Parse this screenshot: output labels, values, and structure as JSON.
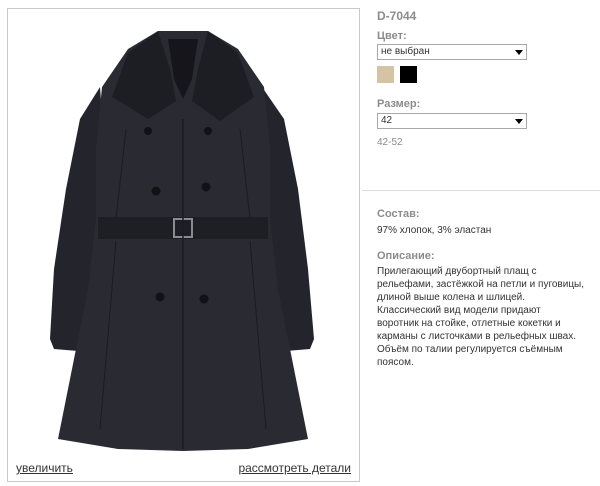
{
  "product": {
    "sku": "D-7044",
    "color_label": "Цвет:",
    "color_selected": "не выбран",
    "swatches": [
      {
        "name": "beige",
        "color": "#d6c3a3"
      },
      {
        "name": "black",
        "color": "#000000"
      }
    ],
    "size_label": "Размер:",
    "size_selected": "42",
    "size_range": "42-52",
    "composition_label": "Состав:",
    "composition": "97% хлопок, 3% эластан",
    "description_label": "Описание:",
    "description_lines": [
      "Прилегающий двубортный плащ с",
      "рельефами, застёжкой на петли и пуговицы,",
      "длиной выше колена и шлицей.",
      "Классический вид модели придают",
      "воротник на стойке, отлетные кокетки и",
      "карманы с листочками в рельефных швах.",
      "Объём по талии регулируется съёмным",
      "поясом."
    ]
  },
  "photo": {
    "zoom_link": "увеличить",
    "details_link": "рассмотреть детали",
    "coat_color": "#2a2a33"
  }
}
